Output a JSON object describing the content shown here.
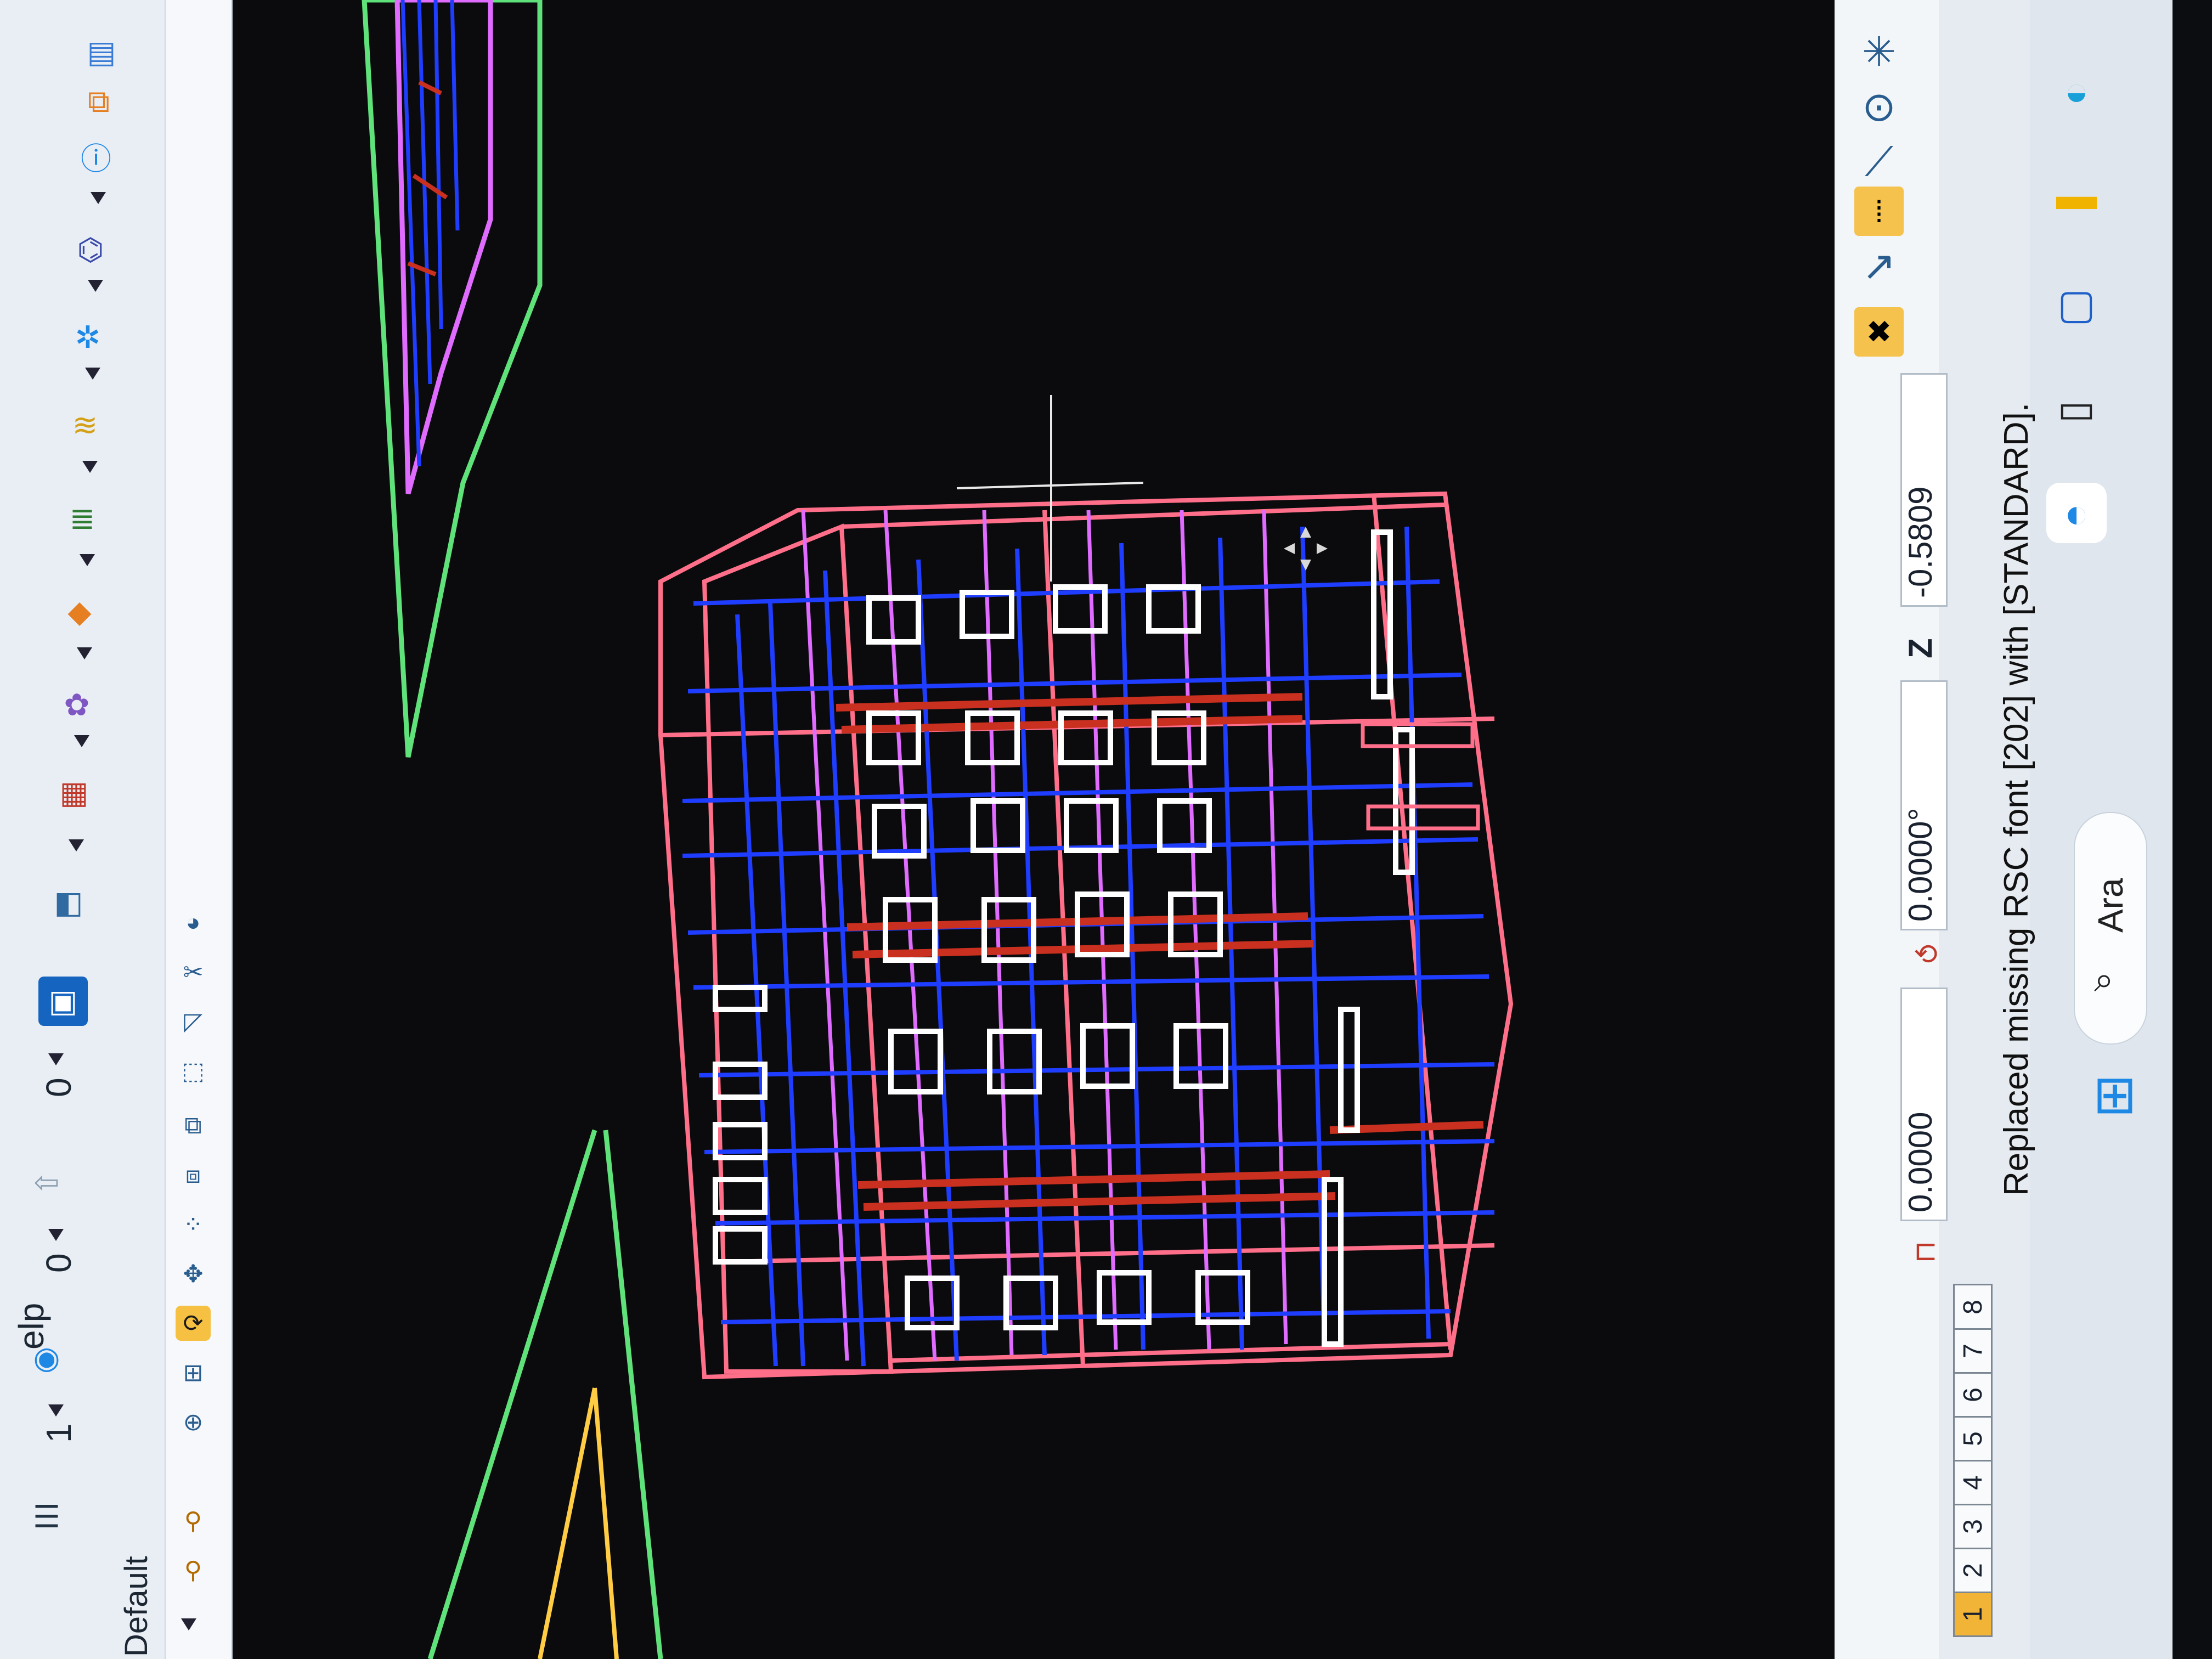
{
  "toolbar": {
    "menu_label": "elp",
    "level_value_1": "1",
    "level_value_2": "0",
    "level_value_3": "0",
    "model_name": "Default"
  },
  "status": {
    "message": "Replaced missing RSC font [202] with [STANDARD].",
    "x_value": "0.0000",
    "angle_value": "0.0000°",
    "z_label": "Z",
    "z_value": "-0.5809"
  },
  "view_buttons": [
    "1",
    "2",
    "3",
    "4",
    "5",
    "6",
    "7",
    "8"
  ],
  "taskbar": {
    "search_placeholder": "Ara"
  },
  "colors": {
    "viewport_bg": "#0b0b0d",
    "wire_blue": "#1f3dff",
    "wire_pink": "#ff6f8a",
    "wire_red": "#c9301f",
    "wire_magenta": "#e06bff",
    "wire_white": "#ffffff",
    "wire_green": "#5fe27a",
    "wire_yellow": "#ffcc44"
  }
}
